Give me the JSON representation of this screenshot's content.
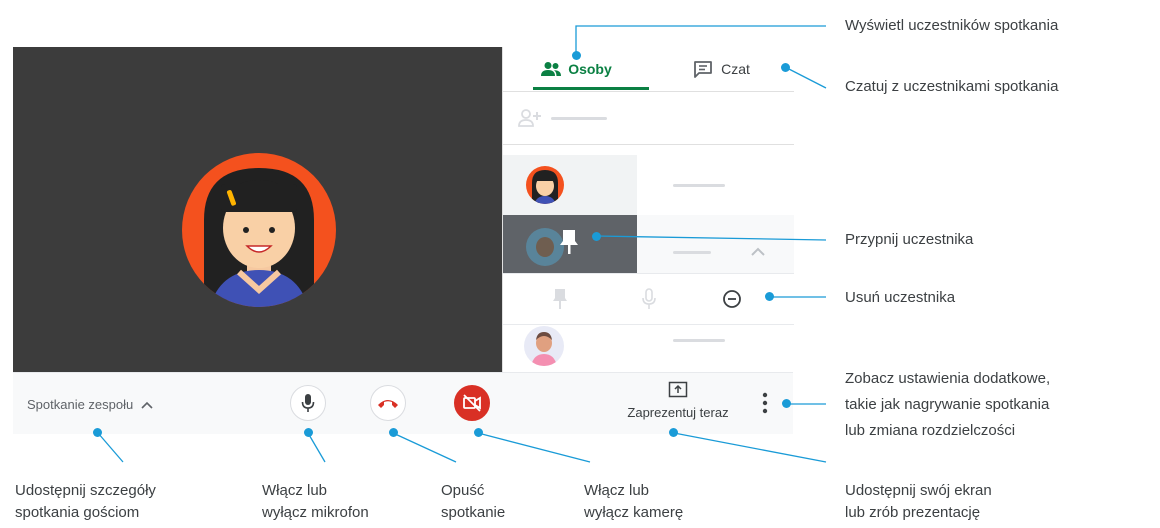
{
  "panel": {
    "tabs": [
      {
        "label": "Osoby",
        "icon": "people-icon"
      },
      {
        "label": "Czat",
        "icon": "chat-icon"
      }
    ]
  },
  "meeting": {
    "name_label": "Spotkanie zespołu",
    "present_label": "Zaprezentuj teraz"
  },
  "callouts": {
    "people": "Wyświetl uczestników spotkania",
    "chat": "Czatuj z uczestnikami spotkania",
    "pin": "Przypnij uczestnika",
    "remove": "Usuń uczestnika",
    "more_1": "Zobacz ustawienia dodatkowe,",
    "more_2": "takie jak nagrywanie spotkania",
    "more_3": "lub zmiana rozdzielczości"
  },
  "bottom_labels": {
    "share_1": "Udostępnij szczegóły",
    "share_2": "spotkania gościom",
    "mic_1": "Włącz lub",
    "mic_2": "wyłącz mikrofon",
    "leave_1": "Opuść",
    "leave_2": "spotkanie",
    "cam_1": "Włącz lub",
    "cam_2": "wyłącz kamerę",
    "present_1": "Udostępnij swój ekran",
    "present_2": "lub zrób prezentację"
  },
  "colors": {
    "accent_green": "#0b8043",
    "leave_red": "#d93025",
    "callout_blue": "#1a9bd7",
    "stage_bg": "#3c3c3c",
    "avatar_orange": "#f4511e"
  }
}
